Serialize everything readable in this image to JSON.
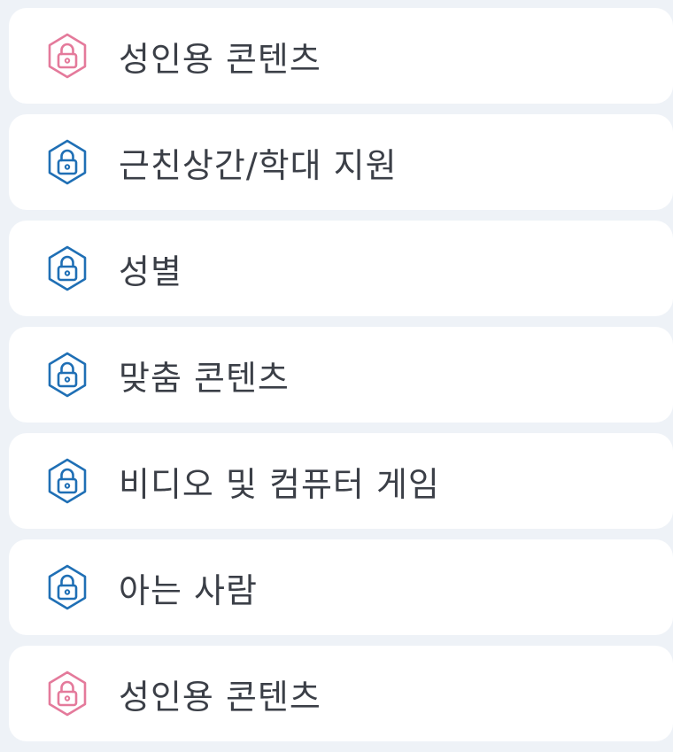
{
  "colors": {
    "background": "#eef2f7",
    "card": "#ffffff",
    "text": "#3b3f47",
    "pink_icon": "#e47a9b",
    "blue_icon": "#1f6fb5"
  },
  "items": [
    {
      "label": "성인용 콘텐츠",
      "icon": "pink-lock-icon"
    },
    {
      "label": "근친상간/학대 지원",
      "icon": "blue-lock-icon"
    },
    {
      "label": "성별",
      "icon": "blue-lock-icon"
    },
    {
      "label": "맞춤 콘텐츠",
      "icon": "blue-lock-icon"
    },
    {
      "label": "비디오 및 컴퓨터 게임",
      "icon": "blue-lock-icon"
    },
    {
      "label": "아는 사람",
      "icon": "blue-lock-icon"
    },
    {
      "label": "성인용 콘텐츠",
      "icon": "pink-lock-icon"
    }
  ]
}
